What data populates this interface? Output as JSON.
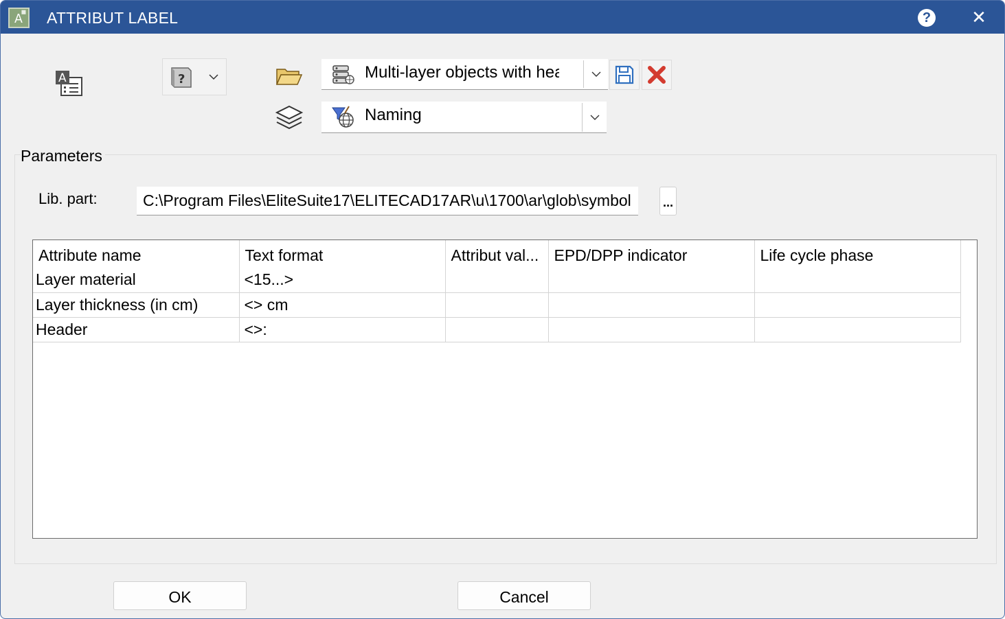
{
  "window": {
    "title": "ATTRIBUT LABEL",
    "title_color": "#2b5597",
    "help_label": "?",
    "close_label": "✕"
  },
  "toolbar": {
    "label_icon": "attribute-label-icon",
    "help_combo_icon": "help-book-icon",
    "folder_icon": "open-folder-icon",
    "layers_icon": "layers-icon",
    "template": {
      "icon": "multi-layer-database-icon",
      "value": "Multi-layer objects with header"
    },
    "category": {
      "icon": "naming-globe-filter-icon",
      "value": "Naming"
    },
    "save_icon": "save-icon",
    "delete_icon": "delete-x-icon"
  },
  "parameters": {
    "title": "Parameters",
    "lib_part_label": "Lib. part:",
    "lib_part_value": "C:\\Program Files\\EliteSuite17\\ELITECAD17AR\\u\\1700\\ar\\glob\\symbol",
    "browse_label": "..."
  },
  "table": {
    "columns": [
      "Attribute name",
      "Text format",
      "Attribut val...",
      "EPD/DPP indicator",
      "Life cycle phase"
    ],
    "rows": [
      [
        "Layer material",
        "<15...>",
        "",
        "",
        ""
      ],
      [
        "Layer thickness (in cm)",
        "<> cm",
        "",
        "",
        ""
      ],
      [
        "Header",
        "<>:",
        "",
        "",
        ""
      ]
    ]
  },
  "footer": {
    "ok_label": "OK",
    "cancel_label": "Cancel"
  }
}
